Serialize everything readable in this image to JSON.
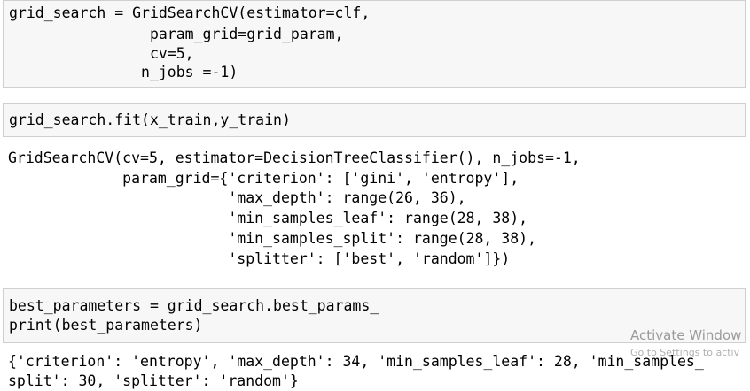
{
  "cells": [
    {
      "lines": [
        "grid_search = GridSearchCV(estimator=clf,",
        "                param_grid=grid_param,",
        "                cv=5,",
        "               n_jobs =-1)"
      ]
    },
    {
      "lines": [
        "grid_search.fit(x_train,y_train)"
      ],
      "output": [
        "GridSearchCV(cv=5, estimator=DecisionTreeClassifier(), n_jobs=-1,",
        "             param_grid={'criterion': ['gini', 'entropy'],",
        "                         'max_depth': range(26, 36),",
        "                         'min_samples_leaf': range(28, 38),",
        "                         'min_samples_split': range(28, 38),",
        "                         'splitter': ['best', 'random']})"
      ]
    },
    {
      "lines": [
        "best_parameters = grid_search.best_params_",
        "print(best_parameters)"
      ],
      "output": [
        "{'criterion': 'entropy', 'max_depth': 34, 'min_samples_leaf': 28, 'min_samples_",
        "split': 30, 'splitter': 'random'}"
      ]
    }
  ],
  "watermark": {
    "title": "Activate Window",
    "subtitle": "Go to Settings to activ"
  }
}
